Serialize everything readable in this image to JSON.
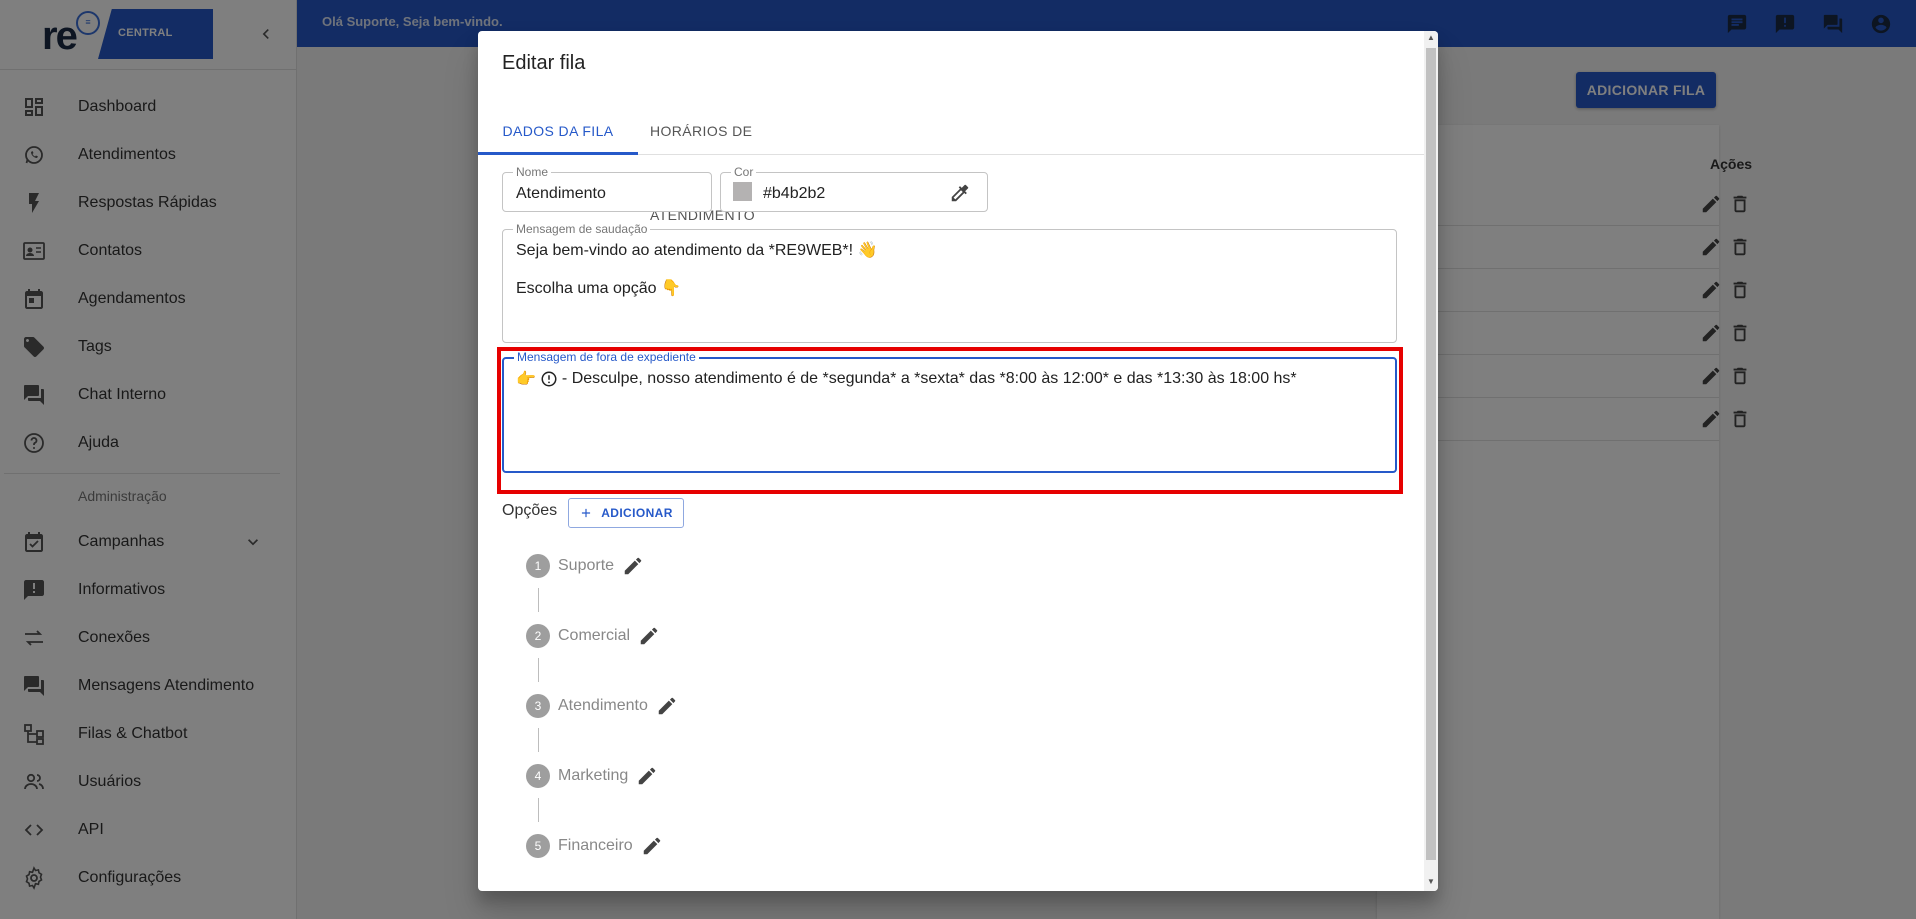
{
  "brand": {
    "logo_text": "re",
    "logo_box": "CENTRAL",
    "brand_color": "#2659c9"
  },
  "topbar": {
    "welcome": "Olá Suporte, Seja bem-vindo."
  },
  "sidebar": {
    "items": [
      {
        "label": "Dashboard",
        "icon": "dashboard-icon"
      },
      {
        "label": "Atendimentos",
        "icon": "whatsapp-icon"
      },
      {
        "label": "Respostas Rápidas",
        "icon": "flash-icon"
      },
      {
        "label": "Contatos",
        "icon": "contact-card-icon"
      },
      {
        "label": "Agendamentos",
        "icon": "calendar-icon"
      },
      {
        "label": "Tags",
        "icon": "tag-icon"
      },
      {
        "label": "Chat Interno",
        "icon": "chat-icon"
      },
      {
        "label": "Ajuda",
        "icon": "help-icon"
      }
    ],
    "admin_header": "Administração",
    "admin_items": [
      {
        "label": "Campanhas",
        "icon": "event-icon"
      },
      {
        "label": "Informativos",
        "icon": "announcement-icon"
      },
      {
        "label": "Conexões",
        "icon": "swap-icon"
      },
      {
        "label": "Mensagens Atendimento",
        "icon": "forum-icon"
      },
      {
        "label": "Filas & Chatbot",
        "icon": "tree-icon"
      },
      {
        "label": "Usuários",
        "icon": "people-icon"
      },
      {
        "label": "API",
        "icon": "code-icon"
      },
      {
        "label": "Configurações",
        "icon": "settings-icon"
      }
    ]
  },
  "main": {
    "add_queue": "ADICIONAR FILA",
    "actions_header": "Ações",
    "row_count": 6
  },
  "modal": {
    "title": "Editar fila",
    "tabs": [
      {
        "label": "DADOS DA FILA",
        "active": true
      },
      {
        "label": "HORÁRIOS DE ATENDIMENTO",
        "active": false
      }
    ],
    "nome": {
      "label": "Nome",
      "value": "Atendimento"
    },
    "cor": {
      "label": "Cor",
      "value": "#b4b2b2"
    },
    "saudacao": {
      "label": "Mensagem de saudação",
      "line1": "Seja bem-vindo ao atendimento da *RE9WEB*! 👋",
      "line2": "Escolha uma opção 👇"
    },
    "fora": {
      "label": "Mensagem de fora de expediente",
      "prefix": "👉",
      "text": "- Desculpe, nosso atendimento é de *segunda* a *sexta* das *8:00 às 12:00* e das *13:30 às 18:00 hs*"
    },
    "opcoes_label": "Opções",
    "add_label": "ADICIONAR",
    "options": [
      {
        "n": "1",
        "label": "Suporte"
      },
      {
        "n": "2",
        "label": "Comercial"
      },
      {
        "n": "3",
        "label": "Atendimento"
      },
      {
        "n": "4",
        "label": "Marketing"
      },
      {
        "n": "5",
        "label": "Financeiro"
      }
    ]
  }
}
